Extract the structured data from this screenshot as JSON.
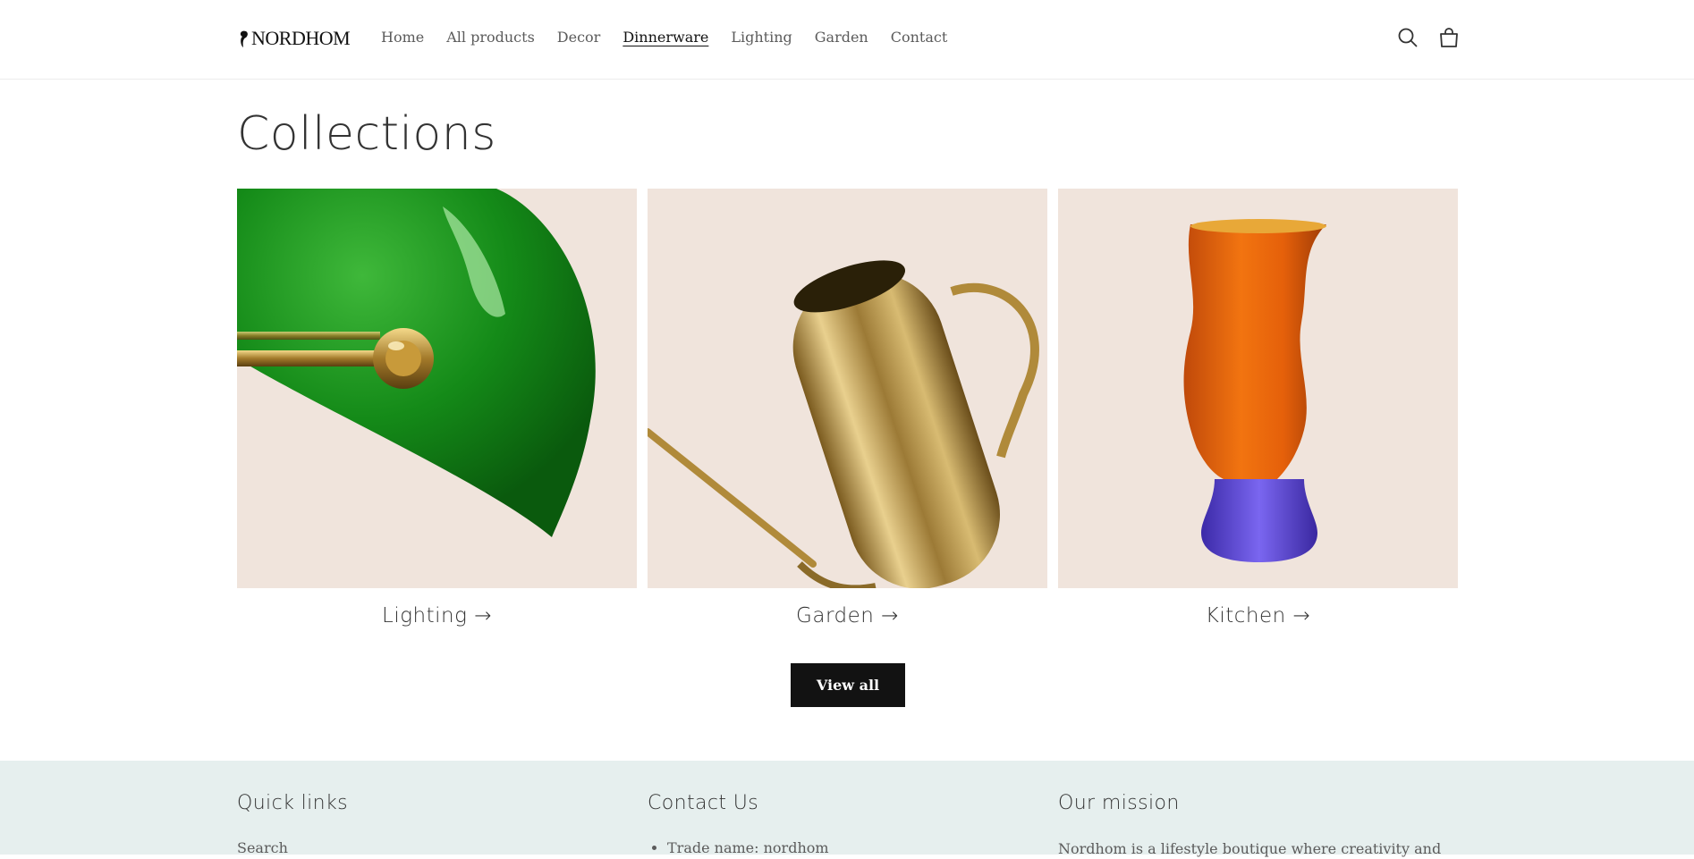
{
  "header": {
    "logo_text": "Nordhom",
    "nav": [
      {
        "label": "Home"
      },
      {
        "label": "All products"
      },
      {
        "label": "Decor"
      },
      {
        "label": "Dinnerware",
        "active": true
      },
      {
        "label": "Lighting"
      },
      {
        "label": "Garden"
      },
      {
        "label": "Contact"
      }
    ],
    "icons": [
      "search-icon",
      "cart-icon"
    ]
  },
  "main": {
    "title": "Collections",
    "collections": [
      {
        "label": "Lighting →",
        "image": "green-bankers-lamp-shade"
      },
      {
        "label": "Garden →",
        "image": "brass-watering-can"
      },
      {
        "label": "Kitchen →",
        "image": "orange-glass-on-purple-foot"
      }
    ],
    "view_all_label": "View all"
  },
  "footer": {
    "quick_links": {
      "heading": "Quick links",
      "links": [
        "Search"
      ]
    },
    "contact": {
      "heading": "Contact Us",
      "items": [
        "Trade name: nordhom"
      ]
    },
    "mission": {
      "heading": "Our mission",
      "text": "Nordhom is a lifestyle boutique where creativity and"
    }
  },
  "colors": {
    "card_background": "#f0e4dc",
    "footer_background": "#e6efee",
    "button_background": "#121212",
    "text": "#121212"
  }
}
